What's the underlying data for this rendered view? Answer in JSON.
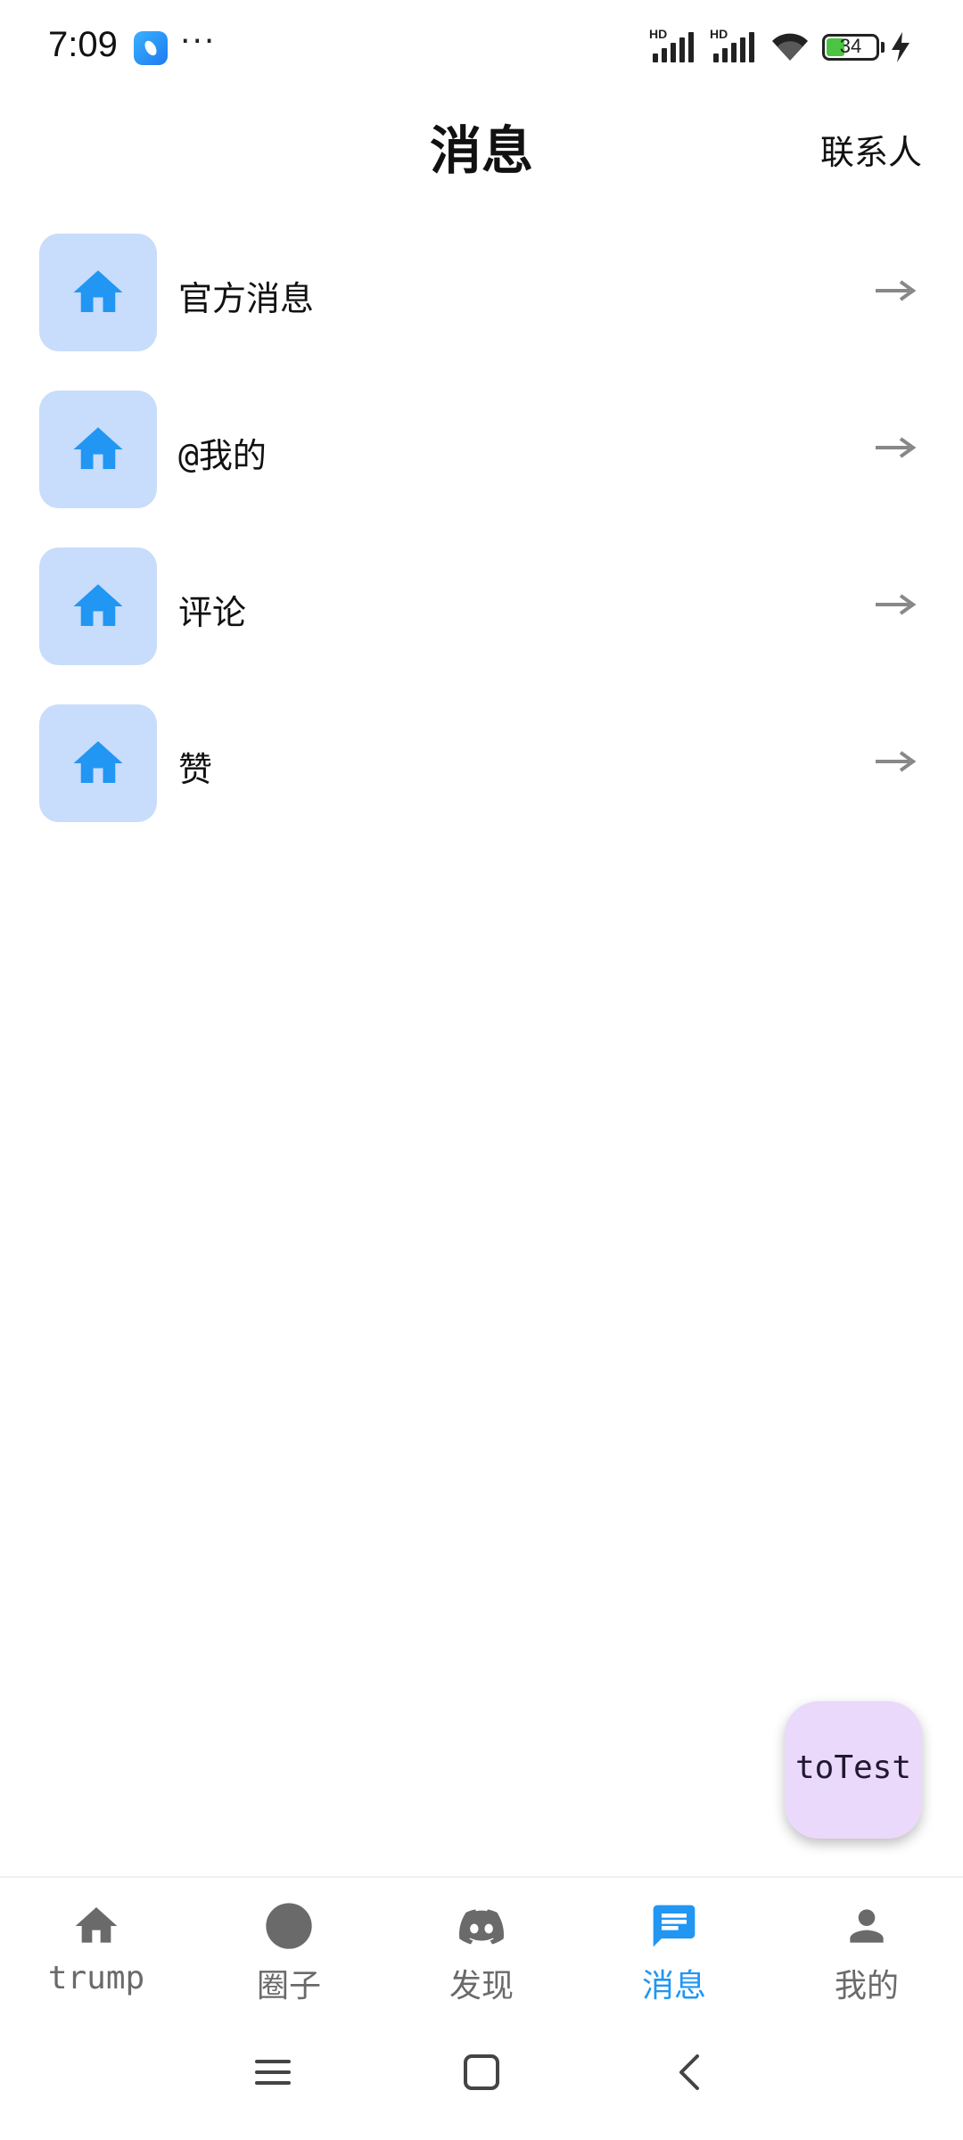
{
  "status_bar": {
    "time": "7:09",
    "dots": "···",
    "battery_level": "34",
    "hd_label": "HD"
  },
  "header": {
    "title": "消息",
    "contacts_label": "联系人"
  },
  "messages": [
    {
      "label": "官方消息",
      "icon": "home-icon"
    },
    {
      "label": "@我的",
      "icon": "home-icon"
    },
    {
      "label": "评论",
      "icon": "home-icon"
    },
    {
      "label": "赞",
      "icon": "home-icon"
    }
  ],
  "fab": {
    "label": "toTest"
  },
  "bottom_nav": {
    "items": [
      {
        "label": "trump",
        "icon": "home-icon",
        "active": false
      },
      {
        "label": "圈子",
        "icon": "circle-icon",
        "active": false
      },
      {
        "label": "发现",
        "icon": "discord-icon",
        "active": false
      },
      {
        "label": "消息",
        "icon": "message-icon",
        "active": true
      },
      {
        "label": "我的",
        "icon": "person-icon",
        "active": false
      }
    ]
  },
  "colors": {
    "accent": "#2196f3",
    "icon_box": "#c8dcfc",
    "fab_bg": "#ead9fb",
    "inactive": "#6a6a6a"
  }
}
